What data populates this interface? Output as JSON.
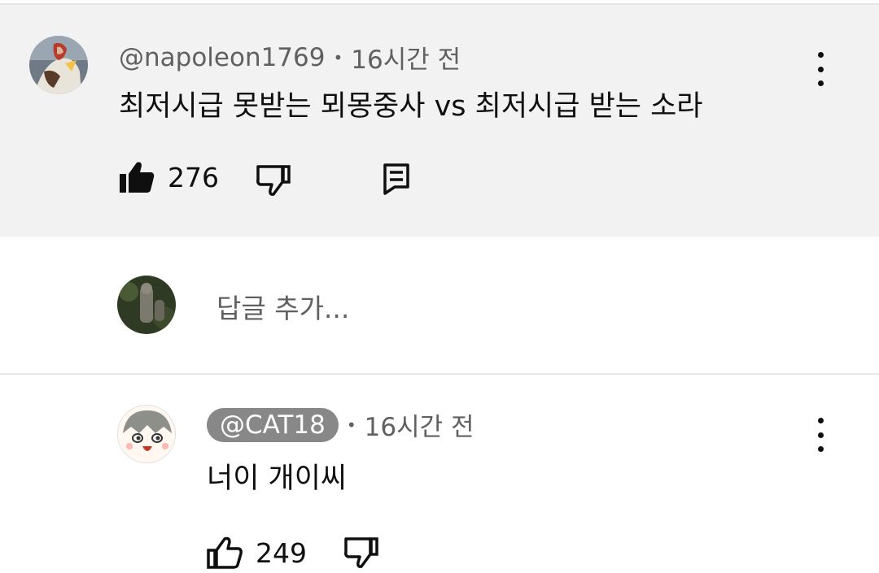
{
  "main_comment": {
    "author": "@napoleon1769",
    "time": "16시간 전",
    "text": "최저시급 못받는 뫼몽중사 vs 최저시급 받는 소라",
    "likes": "276",
    "icons": [
      "liked-thumb-up-icon",
      "thumb-down-icon",
      "reply-icon",
      "more-vert-icon"
    ]
  },
  "reply_box": {
    "placeholder": "답글 추가..."
  },
  "reply_comment": {
    "author": "@CAT18",
    "time": "16시간 전",
    "text": "너이 개이씨",
    "likes": "249",
    "icons": [
      "thumb-up-outline-icon",
      "thumb-down-icon",
      "more-vert-icon"
    ]
  },
  "colors": {
    "highlight_bg": "#f2f2f2",
    "meta_text": "#606060",
    "author_badge_bg": "#888888"
  }
}
